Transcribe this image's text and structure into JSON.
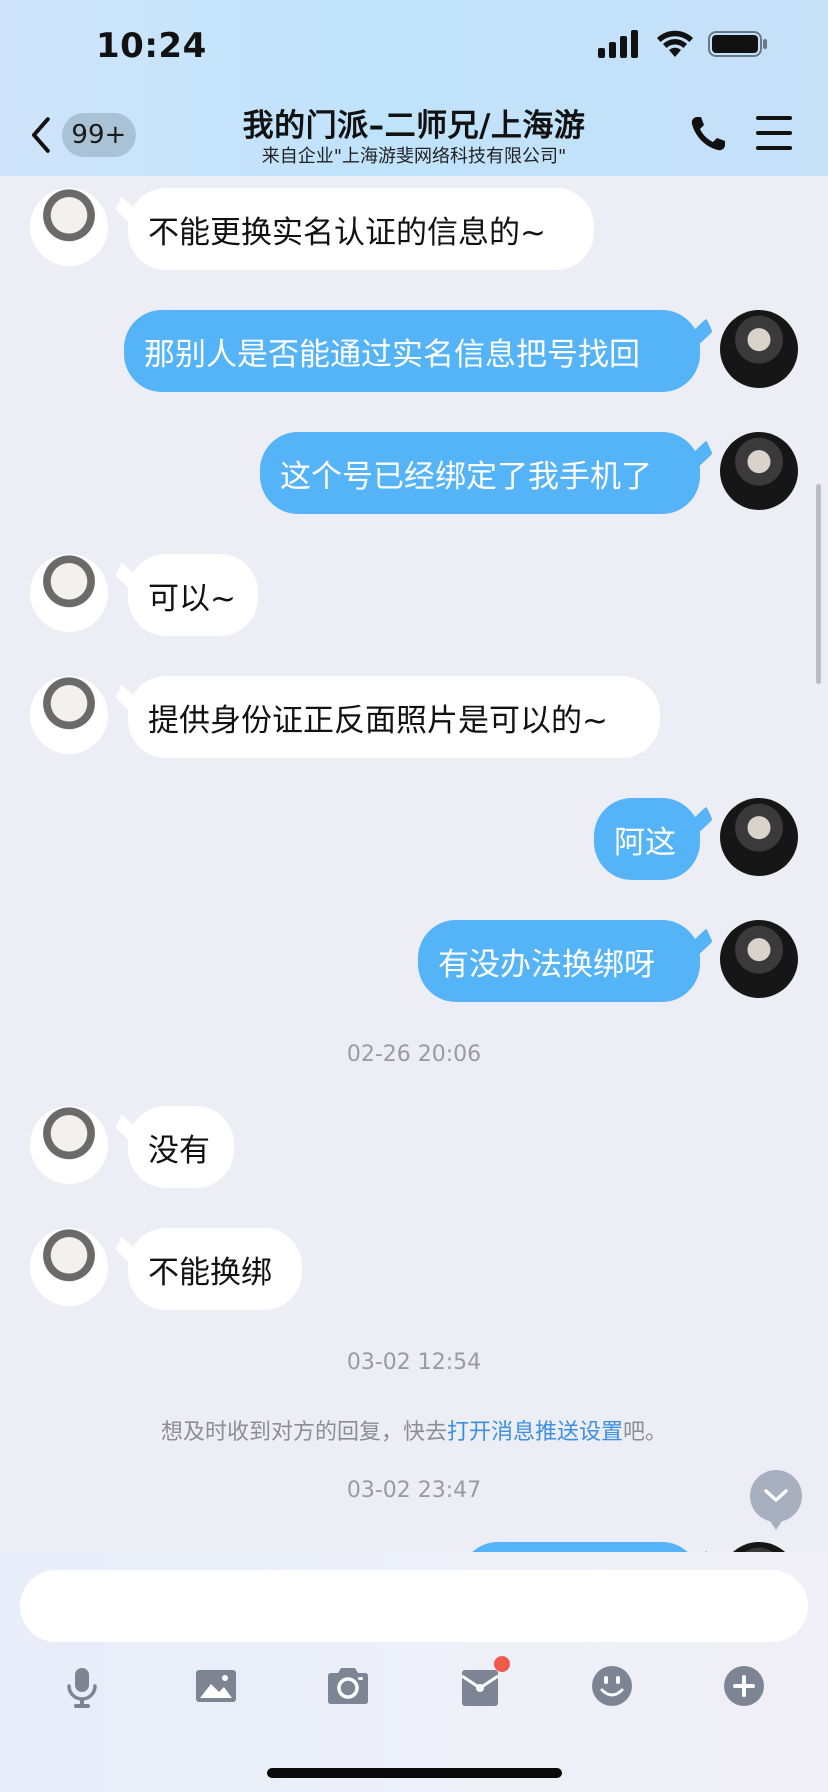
{
  "status": {
    "time": "10:24"
  },
  "header": {
    "unread_count": "99+",
    "title": "我的门派–二师兄/上海游",
    "subtitle": "来自企业\"上海游斐网络科技有限公司\""
  },
  "messages": [
    {
      "side": "in",
      "text": "不能更换实名认证的信息的~"
    },
    {
      "side": "out",
      "text": "那别人是否能通过实名信息把号找回"
    },
    {
      "side": "out",
      "text": "这个号已经绑定了我手机了"
    },
    {
      "side": "in",
      "text": "可以~"
    },
    {
      "side": "in",
      "text": "提供身份证正反面照片是可以的~"
    },
    {
      "side": "out",
      "text": "阿这"
    },
    {
      "side": "out",
      "text": "有没办法换绑呀"
    },
    {
      "side": "time",
      "text": "02-26 20:06"
    },
    {
      "side": "in",
      "text": "没有"
    },
    {
      "side": "in",
      "text": "不能换绑"
    },
    {
      "side": "time",
      "text": "03-02 12:54"
    }
  ],
  "notice": {
    "prefix": "想及时收到对方的回复，快去",
    "link": "打开消息推送设置",
    "suffix": "吧。"
  },
  "last_timestamp": "03-02 23:47",
  "input": {
    "placeholder": ""
  },
  "toolbar_icons": [
    "microphone-icon",
    "image-icon",
    "camera-icon",
    "red-packet-icon",
    "emoji-icon",
    "plus-icon"
  ],
  "colors": {
    "outgoing_bubble": "#55b3f7",
    "incoming_bubble": "#ffffff",
    "link": "#3d8fe0",
    "badge_dot": "#f05a4a"
  }
}
